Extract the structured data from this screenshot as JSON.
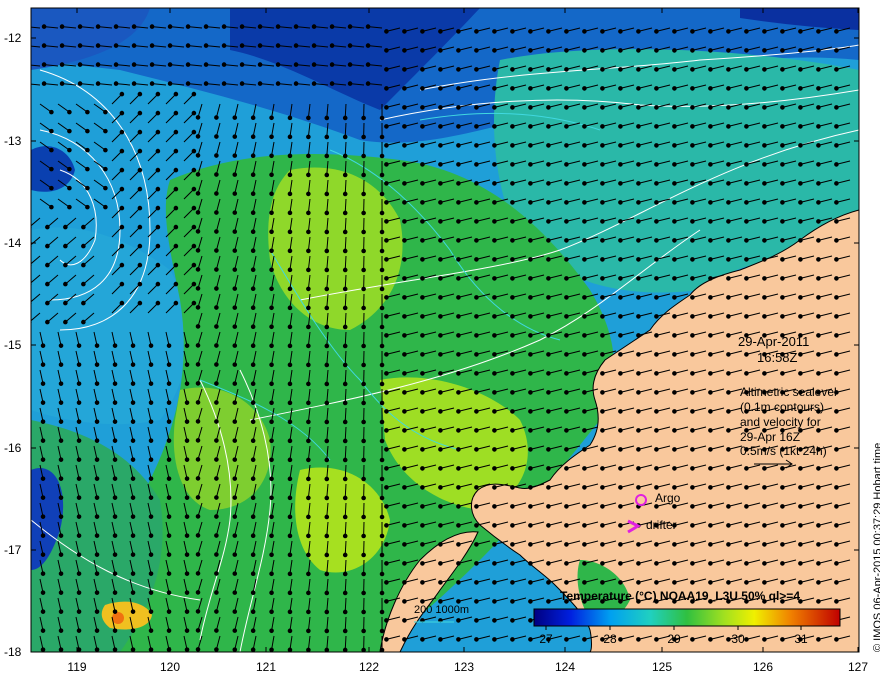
{
  "map": {
    "lat_ticks": [
      "-12",
      "-13",
      "-14",
      "-15",
      "-16",
      "-17",
      "-18"
    ],
    "lon_ticks": [
      "119",
      "120",
      "121",
      "122",
      "123",
      "124",
      "125",
      "126",
      "127"
    ]
  },
  "annotations": {
    "date": "29-Apr-2011",
    "time": "16:58Z",
    "altimetry_lines": [
      "Altimetric sealevel",
      "(0.1m contours)",
      "and velocity for",
      "29-Apr 16Z",
      "0.5m/s (1kt 24h)"
    ],
    "argo_label": "Argo",
    "drifter_label": "drifter",
    "bathy_label": "200  1000m",
    "credit": "© IMOS 06-Apr-2015 00:37:29 Hobart time"
  },
  "colorbar": {
    "title": "Temperature (°C) NOAA19_L3U 50% ql>=4",
    "ticks": [
      "27",
      "28",
      "29",
      "30",
      "31"
    ]
  },
  "colors": {
    "land": "#f9c89c",
    "argo": "#e020e0",
    "drifter": "#e020e0",
    "contour": "#ffffff",
    "bathy": "#40d8e0"
  }
}
